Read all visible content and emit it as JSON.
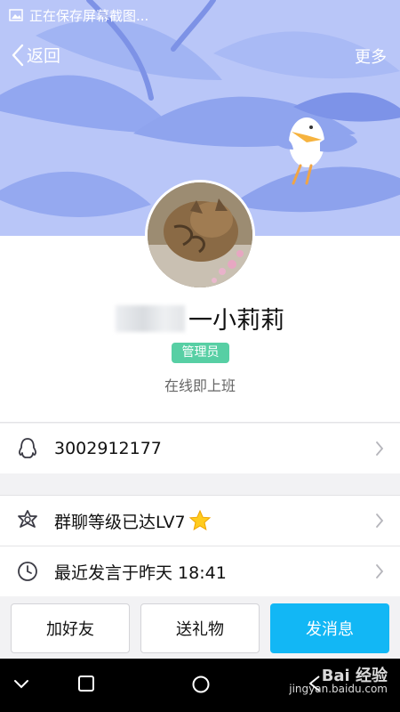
{
  "status_bar": {
    "text": "正在保存屏幕截图..."
  },
  "nav": {
    "back_label": "返回",
    "more_label": "更多"
  },
  "profile": {
    "name_suffix": "一小莉莉",
    "role_badge": "管理员",
    "status": "在线即上班"
  },
  "rows": [
    {
      "icon": "penguin-icon",
      "text": "3002912177"
    },
    {
      "icon": "star-badge-icon",
      "text": "群聊等级已达LV7"
    },
    {
      "icon": "clock-icon",
      "text": "最近发言于昨天 18:41"
    }
  ],
  "actions": {
    "add_friend": "加好友",
    "send_gift": "送礼物",
    "send_message": "发消息"
  },
  "watermark": {
    "line1": "Bai 经验",
    "line2": "jingyan.baidu.com"
  },
  "colors": {
    "banner": "#b7c4f7",
    "badge": "#57cfa4",
    "primary": "#12b7f5"
  }
}
